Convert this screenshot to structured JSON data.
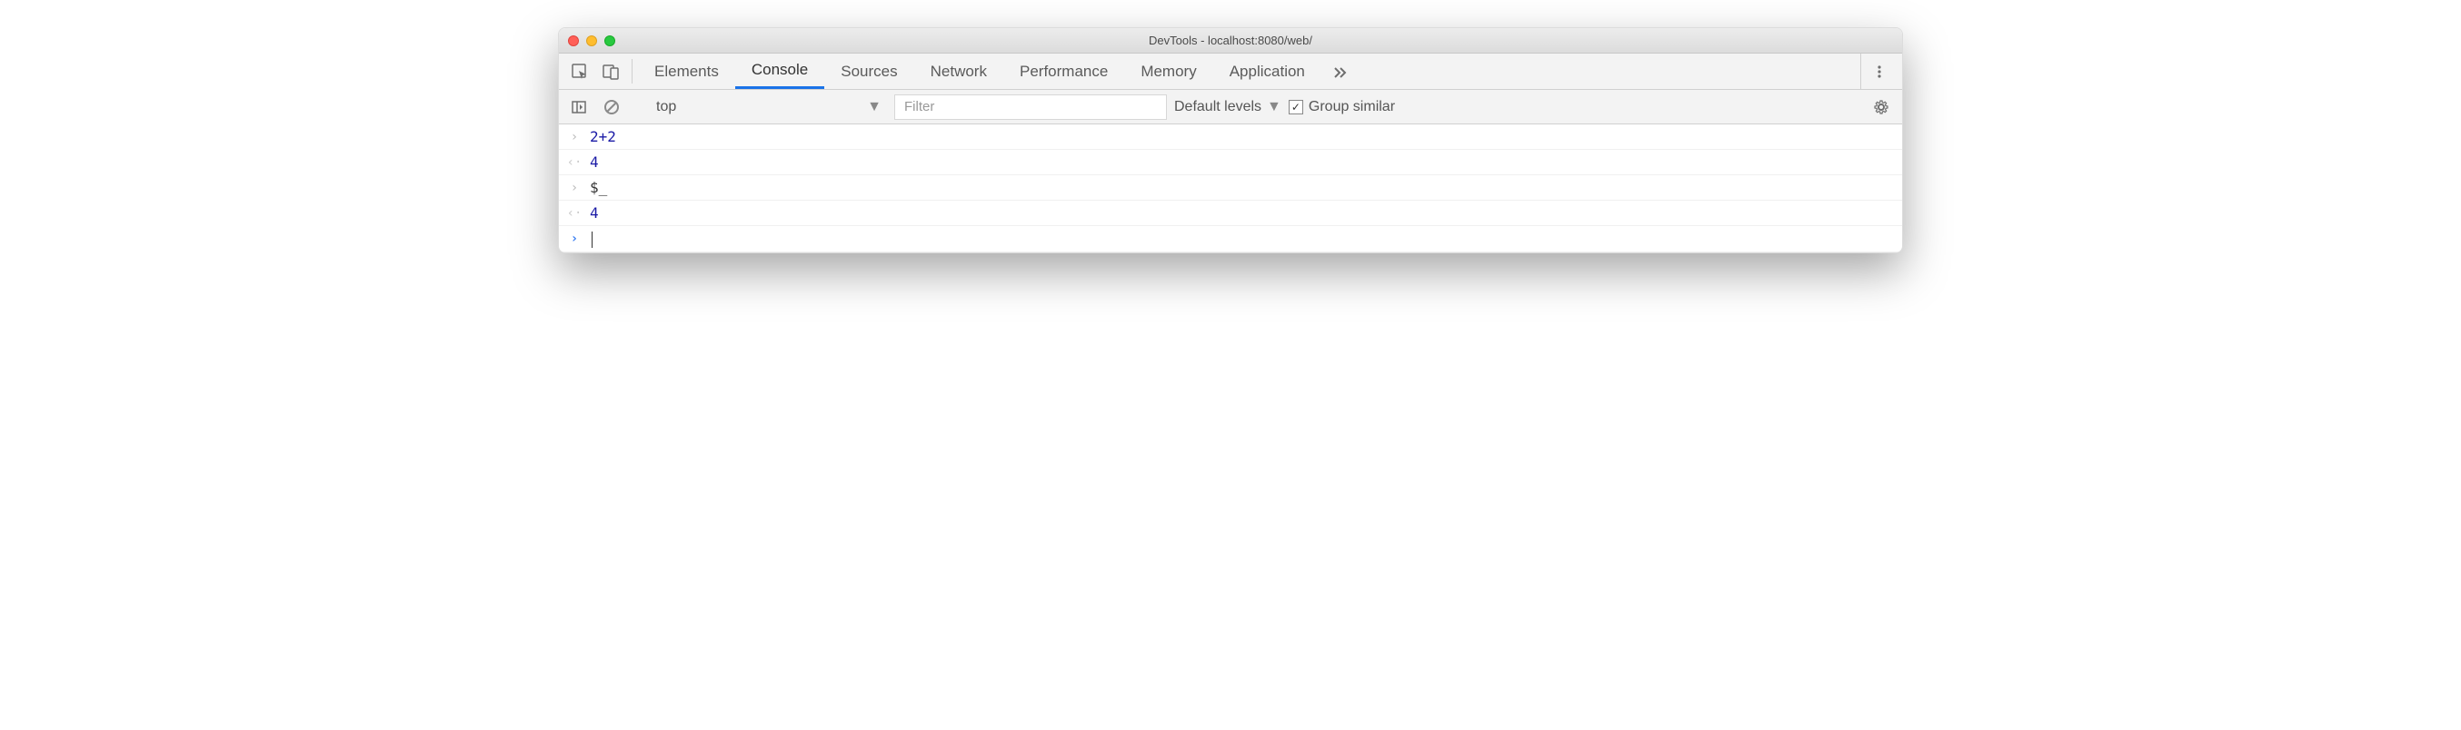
{
  "window": {
    "title": "DevTools - localhost:8080/web/"
  },
  "tabs": {
    "items": [
      "Elements",
      "Console",
      "Sources",
      "Network",
      "Performance",
      "Memory",
      "Application"
    ],
    "active_index": 1
  },
  "toolbar": {
    "context": "top",
    "filter_placeholder": "Filter",
    "levels_label": "Default levels",
    "group_similar_label": "Group similar",
    "group_similar_checked": true
  },
  "console": {
    "rows": [
      {
        "type": "input",
        "tokens": [
          {
            "t": "2",
            "c": "num"
          },
          {
            "t": "+",
            "c": "op"
          },
          {
            "t": "2",
            "c": "num"
          }
        ]
      },
      {
        "type": "output",
        "tokens": [
          {
            "t": "4",
            "c": "num"
          }
        ]
      },
      {
        "type": "input",
        "tokens": [
          {
            "t": "$_",
            "c": "sym"
          }
        ]
      },
      {
        "type": "output",
        "tokens": [
          {
            "t": "4",
            "c": "num"
          }
        ]
      },
      {
        "type": "prompt",
        "tokens": []
      }
    ]
  }
}
